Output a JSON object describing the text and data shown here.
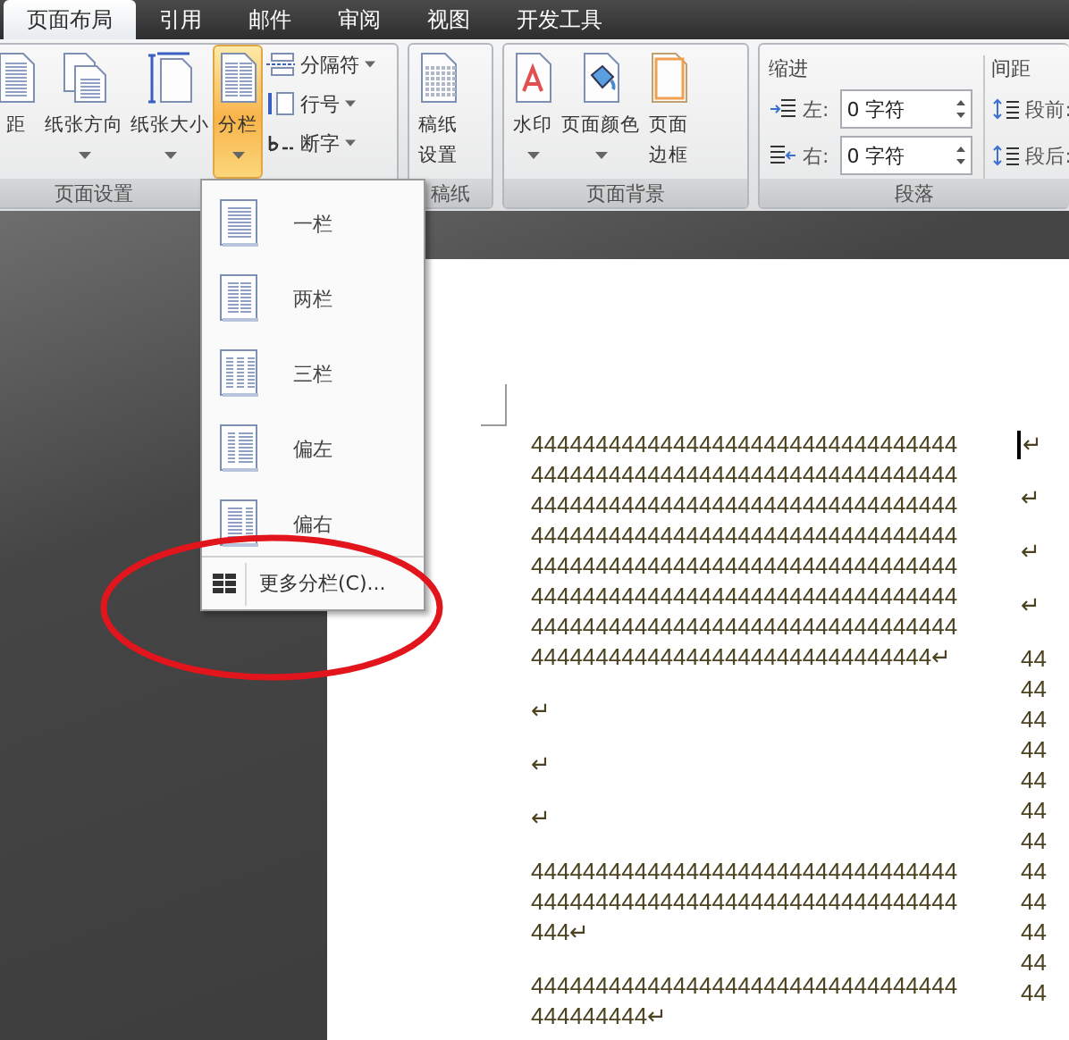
{
  "tabs": [
    {
      "label": "页面布局",
      "selected": true
    },
    {
      "label": "引用",
      "selected": false
    },
    {
      "label": "邮件",
      "selected": false
    },
    {
      "label": "审阅",
      "selected": false
    },
    {
      "label": "视图",
      "selected": false
    },
    {
      "label": "开发工具",
      "selected": false
    }
  ],
  "ribbon": {
    "groups": [
      {
        "kind": "buttons",
        "label": "页面设置",
        "buttons": [
          {
            "kind": "margins",
            "label": "距",
            "dropdown": false,
            "selected": false
          },
          {
            "kind": "orientation",
            "label": "纸张方向",
            "dropdown": true,
            "selected": false
          },
          {
            "kind": "size",
            "label": "纸张大小",
            "dropdown": true,
            "selected": false
          },
          {
            "kind": "columns",
            "label": "分栏",
            "dropdown": true,
            "selected": true
          }
        ],
        "small_buttons": [
          {
            "kind": "breaks",
            "label": "分隔符"
          },
          {
            "kind": "line_numbers",
            "label": "行号"
          },
          {
            "kind": "hyphenation",
            "label": "断字"
          }
        ]
      },
      {
        "kind": "buttons",
        "label": "稿纸",
        "buttons": [
          {
            "kind": "draft",
            "lines": [
              "稿纸",
              "设置"
            ],
            "dropdown": false,
            "selected": false
          }
        ]
      },
      {
        "kind": "buttons",
        "label": "页面背景",
        "buttons": [
          {
            "kind": "watermark",
            "label": "水印",
            "dropdown": true,
            "selected": false
          },
          {
            "kind": "page_color",
            "label": "页面颜色",
            "dropdown": true,
            "selected": false
          },
          {
            "kind": "page_border",
            "lines": [
              "页面",
              "边框"
            ],
            "dropdown": false,
            "selected": false
          }
        ]
      },
      {
        "kind": "paragraph",
        "label": "段落",
        "sections": [
          {
            "title": "缩进",
            "fields": [
              {
                "kind": "indent_left",
                "label": "左:",
                "value": "0 字符"
              },
              {
                "kind": "indent_right",
                "label": "右:",
                "value": "0 字符"
              }
            ]
          },
          {
            "title": "间距",
            "fields": [
              {
                "kind": "space_before",
                "label": "段前:"
              },
              {
                "kind": "space_after",
                "label": "段后:"
              }
            ]
          }
        ]
      }
    ]
  },
  "menu": {
    "items": [
      {
        "kind": "one",
        "label": "一栏"
      },
      {
        "kind": "two",
        "label": "两栏"
      },
      {
        "kind": "three",
        "label": "三栏"
      },
      {
        "kind": "left",
        "label": "偏左"
      },
      {
        "kind": "right",
        "label": "偏右"
      }
    ],
    "footer": {
      "label": "更多分栏(C)..."
    }
  },
  "document": {
    "left_column": [
      {
        "lines": [
          "444444444444444444444444444444444",
          "444444444444444444444444444444444",
          "444444444444444444444444444444444",
          "444444444444444444444444444444444",
          "444444444444444444444444444444444",
          "444444444444444444444444444444444",
          "444444444444444444444444444444444",
          "4444444444444444444444444444444↵"
        ]
      },
      {
        "lines": [
          "↵"
        ]
      },
      {
        "lines": [
          "↵"
        ]
      },
      {
        "lines": [
          "↵"
        ]
      },
      {
        "lines": [
          "444444444444444444444444444444444",
          "444444444444444444444444444444444",
          "444↵"
        ]
      },
      {
        "lines": [
          "444444444444444444444444444444444",
          "444444444↵"
        ]
      }
    ],
    "right_column": [
      {
        "cursor": true,
        "lines": [
          "↵"
        ]
      },
      {
        "cursor": false,
        "lines": [
          "↵"
        ]
      },
      {
        "cursor": false,
        "lines": [
          "↵"
        ]
      },
      {
        "cursor": false,
        "lines": [
          "↵"
        ]
      },
      {
        "cursor": false,
        "lines": [
          "44",
          "44",
          "44",
          "44",
          "44",
          "44",
          "44",
          "44",
          "44",
          "44",
          "44",
          "44"
        ]
      }
    ]
  },
  "annotations": [
    {
      "kind": "ellipse"
    }
  ]
}
